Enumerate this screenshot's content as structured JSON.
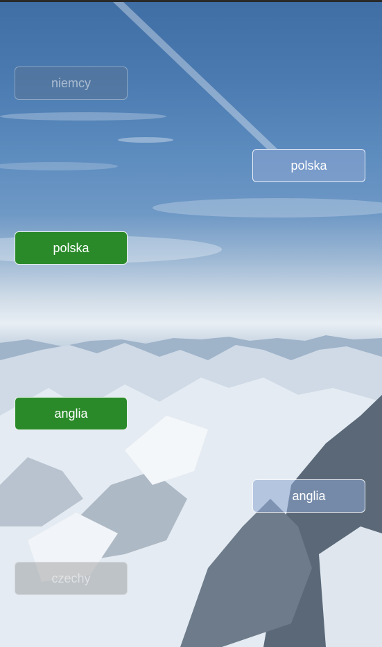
{
  "buttons": [
    {
      "label": "niemcy",
      "state": "disabled"
    },
    {
      "label": "polska",
      "state": "default"
    },
    {
      "label": "polska",
      "state": "correct"
    },
    {
      "label": "anglia",
      "state": "correct"
    },
    {
      "label": "anglia",
      "state": "default"
    },
    {
      "label": "czechy",
      "state": "disabled"
    }
  ],
  "colors": {
    "correct": "#2a8a2a",
    "sky": "#4a7ab0"
  }
}
